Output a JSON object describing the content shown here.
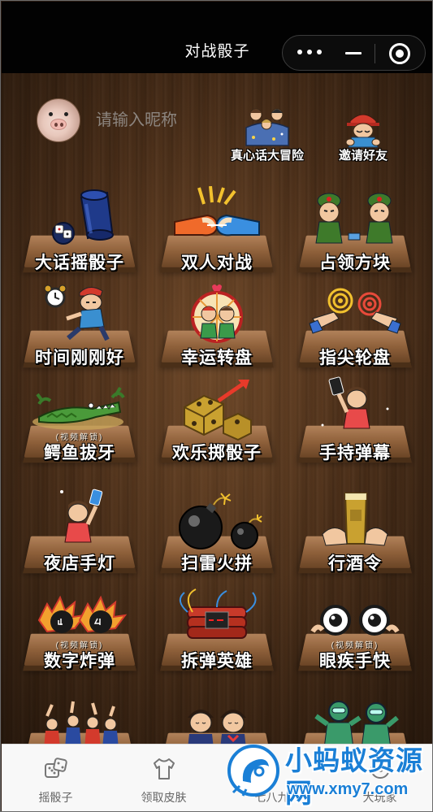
{
  "window": {
    "title": "对战骰子",
    "capsule": [
      "more-icon",
      "minimize-icon",
      "close-icon"
    ]
  },
  "profile": {
    "avatar": "pig-avatar",
    "nickname_placeholder": "请输入昵称"
  },
  "top_actions": [
    {
      "label": "真心话大冒险",
      "icon": "truth-or-dare-icon"
    },
    {
      "label": "邀请好友",
      "icon": "invite-friend-icon"
    }
  ],
  "games": [
    {
      "label": "大话摇骰子",
      "icon": "dice-cup-icon",
      "badge": ""
    },
    {
      "label": "双人对战",
      "icon": "fist-bump-icon",
      "badge": ""
    },
    {
      "label": "占领方块",
      "icon": "soldiers-icon",
      "badge": ""
    },
    {
      "label": "时间刚刚好",
      "icon": "alarm-clock-runner-icon",
      "badge": ""
    },
    {
      "label": "幸运转盘",
      "icon": "lucky-wheel-icon",
      "badge": ""
    },
    {
      "label": "指尖轮盘",
      "icon": "fingertip-wheel-icon",
      "badge": ""
    },
    {
      "label": "鳄鱼拔牙",
      "icon": "crocodile-icon",
      "badge": "(视频解锁)"
    },
    {
      "label": "欢乐掷骰子",
      "icon": "gold-dice-icon",
      "badge": ""
    },
    {
      "label": "手持弹幕",
      "icon": "handheld-banner-icon",
      "badge": ""
    },
    {
      "label": "夜店手灯",
      "icon": "club-light-icon",
      "badge": ""
    },
    {
      "label": "扫雷火拼",
      "icon": "bombs-icon",
      "badge": ""
    },
    {
      "label": "行酒令",
      "icon": "drinking-game-icon",
      "badge": ""
    },
    {
      "label": "数字炸弹",
      "icon": "number-bomb-icon",
      "badge": "(视频解锁)"
    },
    {
      "label": "拆弹英雄",
      "icon": "defuse-bomb-icon",
      "badge": ""
    },
    {
      "label": "眼疾手快",
      "icon": "quick-eyes-icon",
      "badge": "(视频解锁)"
    },
    {
      "label": "",
      "icon": "party-crowd-icon",
      "badge": ""
    },
    {
      "label": "",
      "icon": "couple-icon",
      "badge": ""
    },
    {
      "label": "",
      "icon": "robots-icon",
      "badge": ""
    }
  ],
  "tabbar": [
    {
      "label": "摇骰子",
      "icon": "dice-icon"
    },
    {
      "label": "领取皮肤",
      "icon": "shirt-icon"
    },
    {
      "label": "七八九",
      "icon": "cards-icon"
    },
    {
      "label": "大玩家",
      "icon": "player-icon"
    }
  ],
  "watermark": {
    "title": "小蚂蚁资源网",
    "url": "www.xmy7.com"
  },
  "colors": {
    "titlebar": "#020202",
    "wood": "#5c3a21",
    "tabbar": "#f8f8f8",
    "watermark": "#1a7fd6"
  }
}
